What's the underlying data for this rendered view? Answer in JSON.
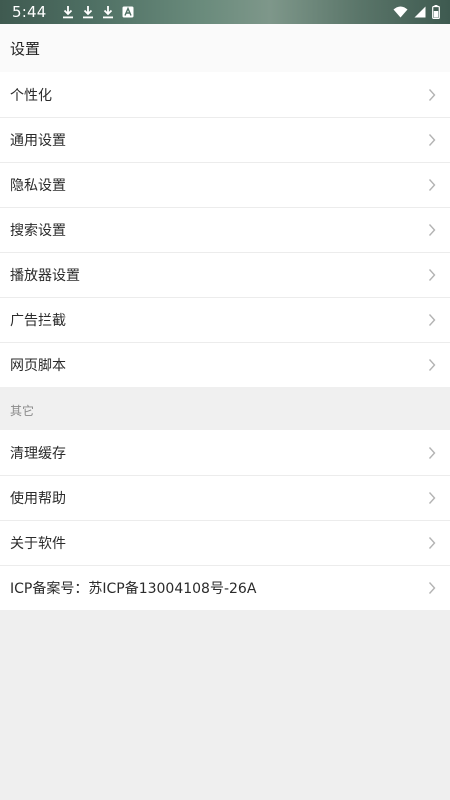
{
  "status_bar": {
    "time": "5:44",
    "icons": [
      "download-icon",
      "download-icon",
      "download-icon",
      "accessibility-icon",
      "wifi-icon",
      "signal-icon",
      "battery-icon"
    ]
  },
  "header": {
    "title": "设置"
  },
  "main_items": [
    {
      "label": "个性化"
    },
    {
      "label": "通用设置"
    },
    {
      "label": "隐私设置"
    },
    {
      "label": "搜索设置"
    },
    {
      "label": "播放器设置"
    },
    {
      "label": "广告拦截"
    },
    {
      "label": "网页脚本"
    }
  ],
  "other_section": {
    "title": "其它",
    "items": [
      {
        "label": "清理缓存"
      },
      {
        "label": "使用帮助"
      },
      {
        "label": "关于软件"
      },
      {
        "label": "ICP备案号：苏ICP备13004108号-26A"
      }
    ]
  },
  "colors": {
    "background": "#efefef",
    "row_background": "#ffffff",
    "divider": "#ececec",
    "chevron": "#b3b3b3"
  }
}
